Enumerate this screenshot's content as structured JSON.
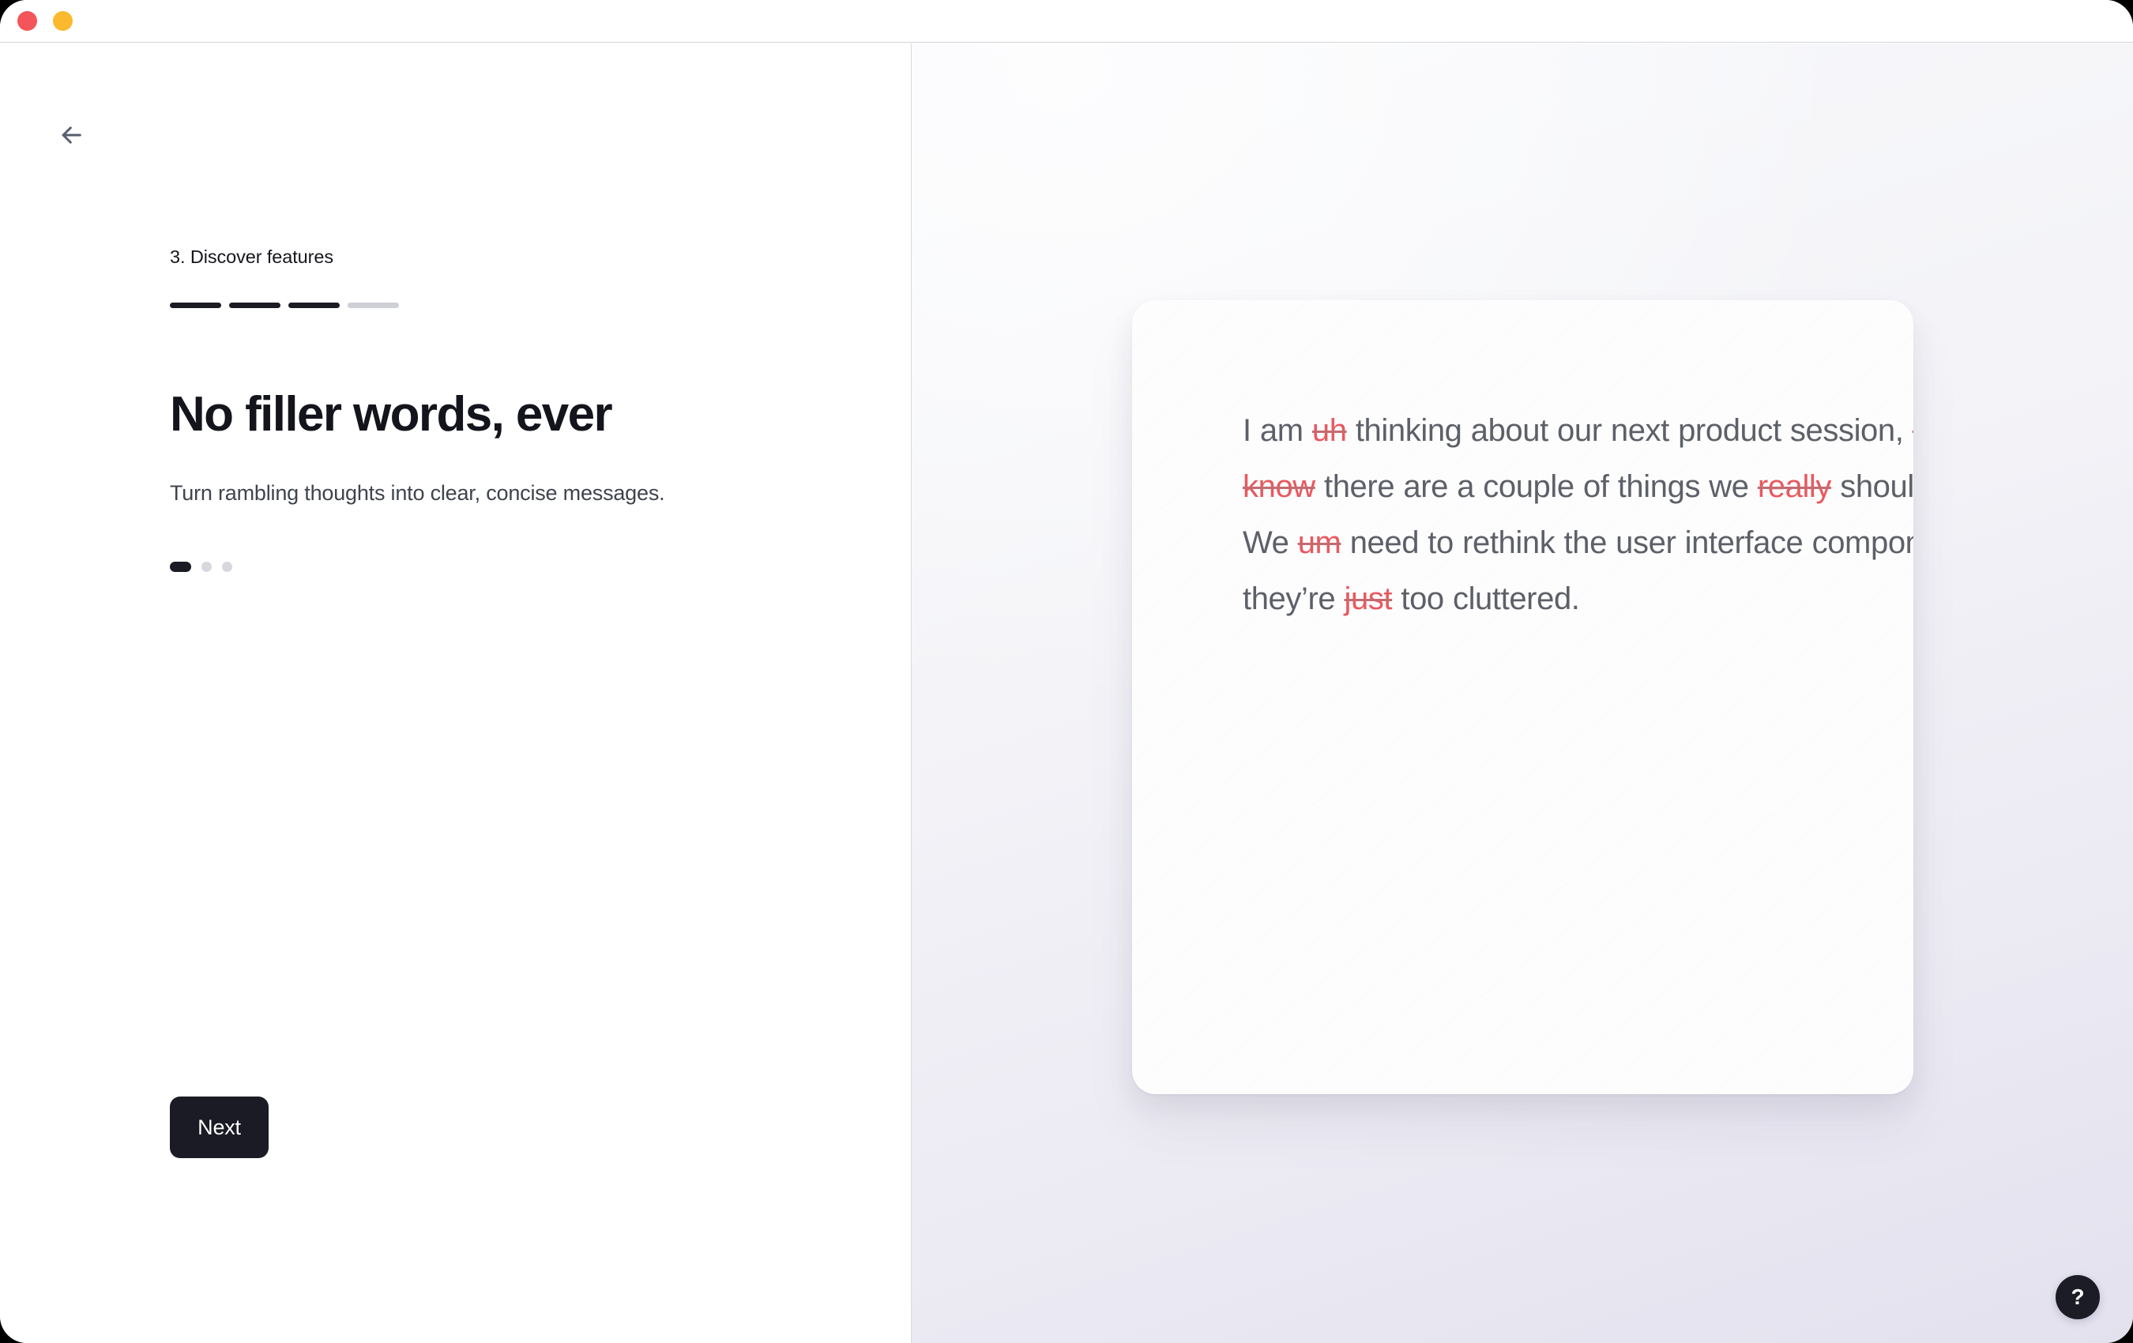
{
  "window": {
    "traffic_lights": [
      {
        "name": "close",
        "color": "#f4555a"
      },
      {
        "name": "minimize",
        "color": "#fbb92e"
      }
    ]
  },
  "left_pane": {
    "back_label": "Back",
    "step_label": "3. Discover features",
    "step_bars": [
      {
        "state": "done"
      },
      {
        "state": "done"
      },
      {
        "state": "done"
      },
      {
        "state": "todo"
      }
    ],
    "headline": "No filler words, ever",
    "subcopy": "Turn rambling thoughts into clear, concise messages.",
    "carousel_dots": [
      {
        "state": "active"
      },
      {
        "state": "inactive"
      },
      {
        "state": "inactive"
      }
    ],
    "next_label": "Next"
  },
  "right_pane": {
    "demo_card": {
      "segments": [
        {
          "text": "I am ",
          "filler": false
        },
        {
          "text": "uh",
          "filler": true
        },
        {
          "text": " thinking about our next product ",
          "filler": false
        },
        {
          "text": "session, ",
          "filler": false
        },
        {
          "text": "and you know",
          "filler": true
        },
        {
          "text": " there are a couple of things we ",
          "filler": false
        },
        {
          "text": "really",
          "filler": true
        },
        {
          "text": " should focus on. We ",
          "filler": false
        },
        {
          "text": "um",
          "filler": true
        },
        {
          "text": " need to rethink the user interface components—they’re ",
          "filler": false
        },
        {
          "text": "just",
          "filler": true
        },
        {
          "text": " too cluttered.",
          "filler": false
        }
      ]
    },
    "help_label": "?"
  },
  "colors": {
    "ink": "#1a1b24",
    "muted_text": "#3f434d",
    "demo_text": "#5d6068",
    "filler_red": "#e8595f",
    "bar_inactive": "#cfd0d6",
    "panel_gradient_start": "#f8f9fb",
    "panel_gradient_end": "#e3e1ee"
  }
}
